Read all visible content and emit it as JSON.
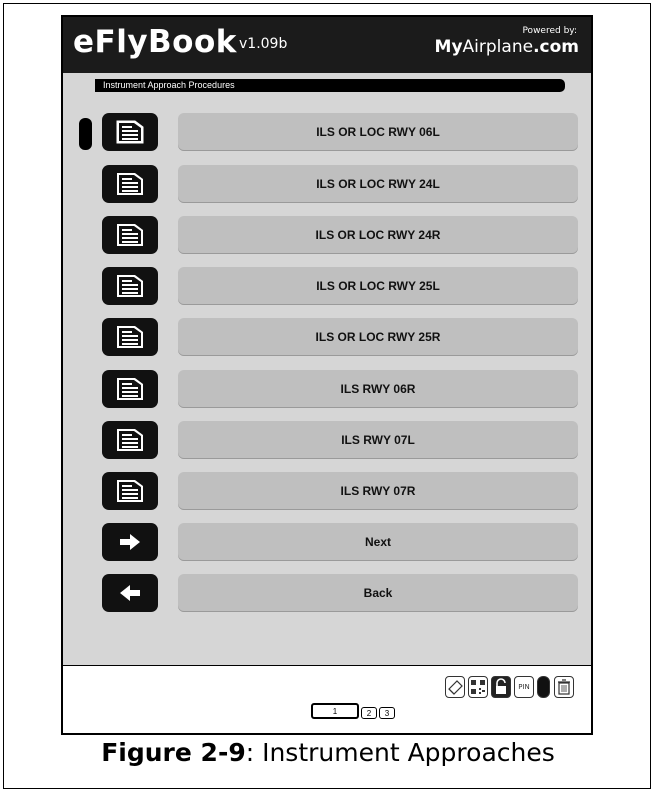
{
  "app": {
    "title": "eFlyBook",
    "version": "v1.09b",
    "powered_by": "Powered by:",
    "brand_bold": "My",
    "brand_rest": "Airplane",
    "brand_suffix": ".com"
  },
  "section": {
    "label": "Instrument Approach Procedures"
  },
  "rows": [
    {
      "label": "ILS OR LOC RWY 06L",
      "icon": "document-icon",
      "selected": true
    },
    {
      "label": "ILS OR LOC RWY 24L",
      "icon": "document-icon"
    },
    {
      "label": "ILS OR LOC RWY 24R",
      "icon": "document-icon"
    },
    {
      "label": "ILS OR LOC RWY 25L",
      "icon": "document-icon"
    },
    {
      "label": "ILS OR LOC RWY 25R",
      "icon": "document-icon"
    },
    {
      "label": "ILS RWY 06R",
      "icon": "document-icon"
    },
    {
      "label": "ILS RWY 07L",
      "icon": "document-icon"
    },
    {
      "label": "ILS RWY 07R",
      "icon": "document-icon"
    },
    {
      "label": "Next",
      "icon": "arrow-right-icon"
    },
    {
      "label": "Back",
      "icon": "arrow-left-icon"
    }
  ],
  "toolbar": {
    "icons": [
      "eraser-icon",
      "qr-code-icon",
      "unlock-icon",
      "pin-icon",
      "selected-indicator-icon",
      "trash-icon"
    ],
    "pin_label": "PIN"
  },
  "pages": {
    "items": [
      "1",
      "2",
      "3"
    ],
    "current": "1"
  },
  "caption": {
    "figure": "Figure 2-9",
    "text": ": Instrument Approaches"
  },
  "colors": {
    "topbar": "#1b1b1b",
    "content_bg": "#d6d6d6",
    "button": "#bfbfbf",
    "icon_bg": "#111111"
  }
}
